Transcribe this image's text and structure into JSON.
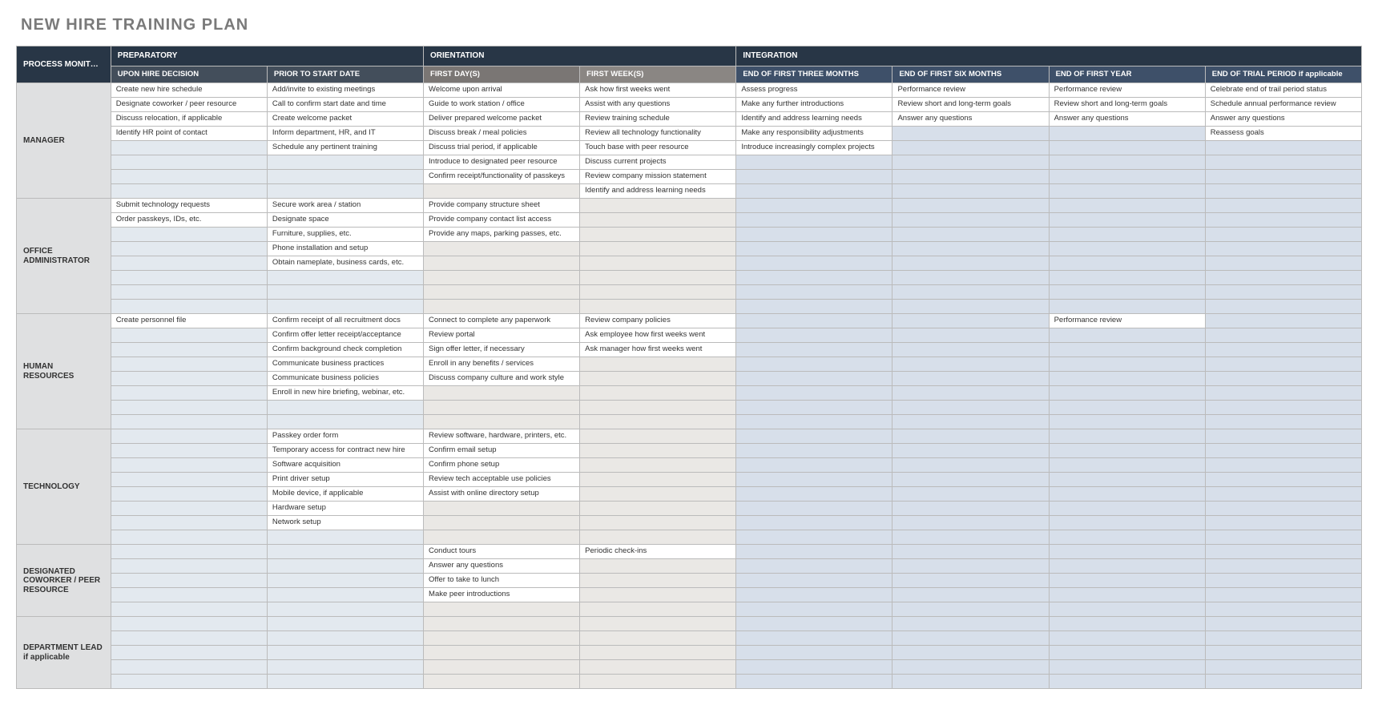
{
  "title": "NEW HIRE TRAINING PLAN",
  "cornerHeader": "PROCESS MONITOR / MENTOR",
  "phases": [
    {
      "label": "PREPARATORY",
      "span": 2
    },
    {
      "label": "ORIENTATION",
      "span": 2
    },
    {
      "label": "INTEGRATION",
      "span": 4
    }
  ],
  "columns": [
    {
      "label": "UPON HIRE DECISION",
      "class": "prep"
    },
    {
      "label": "PRIOR TO START DATE",
      "class": "prep"
    },
    {
      "label": "FIRST DAY(S)",
      "class": "orient1"
    },
    {
      "label": "FIRST WEEK(S)",
      "class": "orient2"
    },
    {
      "label": "END OF FIRST THREE MONTHS",
      "class": "integ"
    },
    {
      "label": "END OF FIRST SIX MONTHS",
      "class": "integ"
    },
    {
      "label": "END OF FIRST YEAR",
      "class": "integ"
    },
    {
      "label": "END OF TRIAL PERIOD if applicable",
      "class": "integ"
    }
  ],
  "sections": [
    {
      "role": "MANAGER",
      "rowCount": 8,
      "rows": [
        [
          "Create new hire schedule",
          "Add/invite to existing meetings",
          "Welcome upon arrival",
          "Ask how first weeks went",
          "Assess progress",
          "Performance review",
          "Performance review",
          "Celebrate end of trail period status"
        ],
        [
          "Designate coworker / peer resource",
          "Call to confirm start date and time",
          "Guide to work station / office",
          "Assist with any questions",
          "Make any further introductions",
          "Review short and long-term goals",
          "Review short and long-term goals",
          "Schedule annual performance review"
        ],
        [
          "Discuss relocation, if applicable",
          "Create welcome packet",
          "Deliver prepared welcome packet",
          "Review training schedule",
          "Identify and address learning needs",
          "Answer any questions",
          "Answer any questions",
          "Answer any questions"
        ],
        [
          "Identify HR point of contact",
          "Inform department, HR, and IT",
          "Discuss break / meal policies",
          "Review all technology functionality",
          "Make any responsibility adjustments",
          "",
          "",
          "Reassess goals"
        ],
        [
          "",
          "Schedule any pertinent training",
          "Discuss trial period, if applicable",
          "Touch base with peer resource",
          "Introduce increasingly complex projects",
          "",
          "",
          ""
        ],
        [
          "",
          "",
          "Introduce to designated peer resource",
          "Discuss current projects",
          "",
          "",
          "",
          ""
        ],
        [
          "",
          "",
          "Confirm receipt/functionality of passkeys",
          "Review company mission statement",
          "",
          "",
          "",
          ""
        ],
        [
          "",
          "",
          "",
          "Identify and address learning needs",
          "",
          "",
          "",
          ""
        ]
      ]
    },
    {
      "role": "OFFICE ADMINISTRATOR",
      "rowCount": 8,
      "rows": [
        [
          "Submit technology requests",
          "Secure work area / station",
          "Provide company structure sheet",
          "",
          "",
          "",
          "",
          ""
        ],
        [
          "Order passkeys, IDs, etc.",
          "Designate space",
          "Provide company contact list access",
          "",
          "",
          "",
          "",
          ""
        ],
        [
          "",
          "Furniture, supplies, etc.",
          "Provide any maps, parking passes, etc.",
          "",
          "",
          "",
          "",
          ""
        ],
        [
          "",
          "Phone installation and setup",
          "",
          "",
          "",
          "",
          "",
          ""
        ],
        [
          "",
          "Obtain nameplate, business cards, etc.",
          "",
          "",
          "",
          "",
          "",
          ""
        ],
        [
          "",
          "",
          "",
          "",
          "",
          "",
          "",
          ""
        ],
        [
          "",
          "",
          "",
          "",
          "",
          "",
          "",
          ""
        ],
        [
          "",
          "",
          "",
          "",
          "",
          "",
          "",
          ""
        ]
      ]
    },
    {
      "role": "HUMAN RESOURCES",
      "rowCount": 8,
      "rows": [
        [
          "Create personnel file",
          "Confirm receipt of all recruitment docs",
          "Connect to complete any paperwork",
          "Review company policies",
          "",
          "",
          "Performance review",
          ""
        ],
        [
          "",
          "Confirm offer letter receipt/acceptance",
          "Review portal",
          "Ask employee how first weeks went",
          "",
          "",
          "",
          ""
        ],
        [
          "",
          "Confirm background check completion",
          "Sign offer letter, if necessary",
          "Ask manager how first weeks went",
          "",
          "",
          "",
          ""
        ],
        [
          "",
          "Communicate business practices",
          "Enroll in any benefits / services",
          "",
          "",
          "",
          "",
          ""
        ],
        [
          "",
          "Communicate business policies",
          "Discuss company culture and work style",
          "",
          "",
          "",
          "",
          ""
        ],
        [
          "",
          "Enroll in new hire briefing, webinar, etc.",
          "",
          "",
          "",
          "",
          "",
          ""
        ],
        [
          "",
          "",
          "",
          "",
          "",
          "",
          "",
          ""
        ],
        [
          "",
          "",
          "",
          "",
          "",
          "",
          "",
          ""
        ]
      ]
    },
    {
      "role": "TECHNOLOGY",
      "rowCount": 8,
      "rows": [
        [
          "",
          "Passkey order form",
          "Review software, hardware, printers, etc.",
          "",
          "",
          "",
          "",
          ""
        ],
        [
          "",
          "Temporary access for contract new hire",
          "Confirm email setup",
          "",
          "",
          "",
          "",
          ""
        ],
        [
          "",
          "Software acquisition",
          "Confirm phone setup",
          "",
          "",
          "",
          "",
          ""
        ],
        [
          "",
          "Print driver setup",
          "Review tech acceptable use policies",
          "",
          "",
          "",
          "",
          ""
        ],
        [
          "",
          "Mobile device, if applicable",
          "Assist with online directory setup",
          "",
          "",
          "",
          "",
          ""
        ],
        [
          "",
          "Hardware setup",
          "",
          "",
          "",
          "",
          "",
          ""
        ],
        [
          "",
          "Network setup",
          "",
          "",
          "",
          "",
          "",
          ""
        ],
        [
          "",
          "",
          "",
          "",
          "",
          "",
          "",
          ""
        ]
      ]
    },
    {
      "role": "DESIGNATED COWORKER / PEER RESOURCE",
      "rowCount": 5,
      "rows": [
        [
          "",
          "",
          "Conduct tours",
          "Periodic check-ins",
          "",
          "",
          "",
          ""
        ],
        [
          "",
          "",
          "Answer any questions",
          "",
          "",
          "",
          "",
          ""
        ],
        [
          "",
          "",
          "Offer to take to lunch",
          "",
          "",
          "",
          "",
          ""
        ],
        [
          "",
          "",
          "Make peer introductions",
          "",
          "",
          "",
          "",
          ""
        ],
        [
          "",
          "",
          "",
          "",
          "",
          "",
          "",
          ""
        ]
      ]
    },
    {
      "role": "DEPARTMENT LEAD",
      "roleNote": "if applicable",
      "rowCount": 5,
      "rows": [
        [
          "",
          "",
          "",
          "",
          "",
          "",
          "",
          ""
        ],
        [
          "",
          "",
          "",
          "",
          "",
          "",
          "",
          ""
        ],
        [
          "",
          "",
          "",
          "",
          "",
          "",
          "",
          ""
        ],
        [
          "",
          "",
          "",
          "",
          "",
          "",
          "",
          ""
        ],
        [
          "",
          "",
          "",
          "",
          "",
          "",
          "",
          ""
        ]
      ]
    }
  ]
}
